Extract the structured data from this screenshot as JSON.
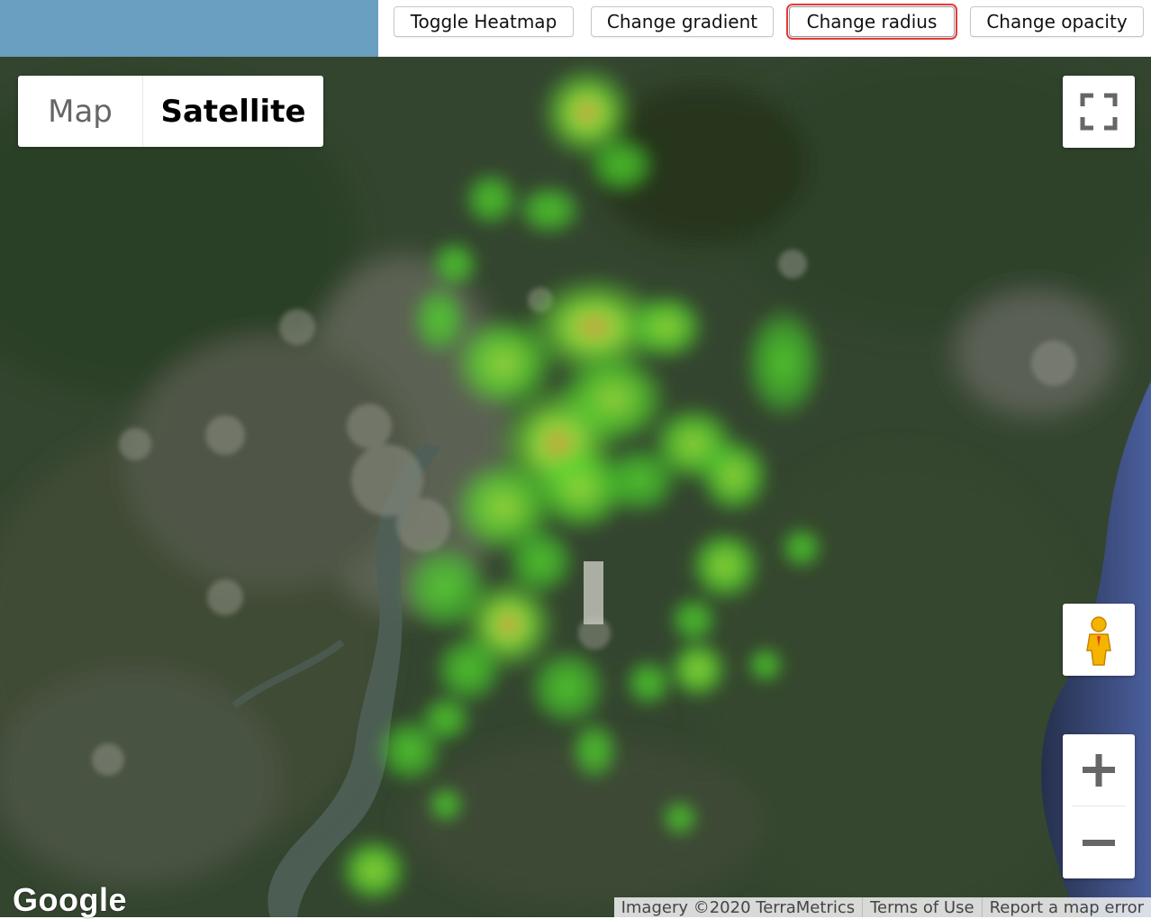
{
  "toolbar": {
    "buttons": [
      {
        "label": "Toggle Heatmap"
      },
      {
        "label": "Change gradient"
      },
      {
        "label": "Change radius",
        "highlighted": true
      },
      {
        "label": "Change opacity"
      }
    ]
  },
  "map": {
    "type_control": {
      "options": [
        "Map",
        "Satellite"
      ],
      "selected": "Satellite"
    },
    "logo_text": "Google",
    "attribution": {
      "imagery": "Imagery ©2020 TerraMetrics",
      "terms": "Terms of Use",
      "report": "Report a map error"
    },
    "icons": {
      "fullscreen": "fullscreen-icon",
      "pegman": "pegman-icon",
      "zoom_in": "plus-icon",
      "zoom_out": "minus-icon"
    },
    "colors": {
      "heat_low": "#46d42a",
      "heat_mid": "#8fe23a",
      "heat_high": "#d9a441",
      "highlight_outline": "#e53935",
      "top_left_panel": "#6a9fc1"
    }
  }
}
